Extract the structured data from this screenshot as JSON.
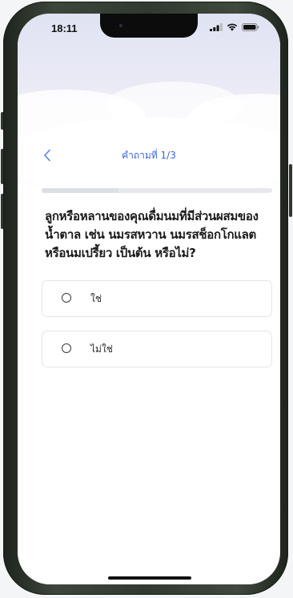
{
  "status_bar": {
    "time": "18:11",
    "signal_icon": "signal-bars-icon",
    "wifi_icon": "wifi-icon",
    "battery_icon": "battery-icon"
  },
  "nav": {
    "back_icon": "chevron-left-icon",
    "title": "คำถามที่ 1/3"
  },
  "progress": {
    "current": 1,
    "total": 3
  },
  "question": {
    "text": "ลูกหรือหลานของคุณดื่มนมที่มีส่วนผสมของน้ำตาล เช่น นมรสหวาน นมรสช็อกโกแลต หรือนมเปรี้ยว เป็นต้น หรือไม่?"
  },
  "options": [
    {
      "label": "ใช่",
      "selected": false
    },
    {
      "label": "ไม่ใช่",
      "selected": false
    }
  ],
  "colors": {
    "accent": "#3d66d6",
    "text": "#1a1a1a",
    "border": "#e3e5e9"
  }
}
